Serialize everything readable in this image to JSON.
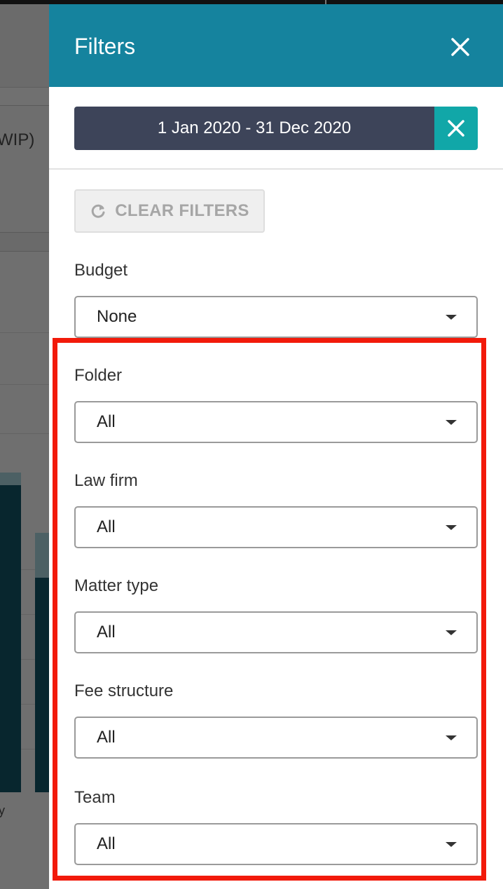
{
  "background": {
    "card_title_fragment": "WIP)",
    "axis_label_fragment": "y"
  },
  "panel": {
    "title": "Filters",
    "close_icon": "close-icon",
    "date_range": {
      "label": "1 Jan 2020 - 31 Dec 2020",
      "clear_icon": "close-icon"
    },
    "clear_filters": {
      "label": "CLEAR FILTERS",
      "icon": "refresh-icon"
    },
    "filters": [
      {
        "label": "Budget",
        "value": "None"
      },
      {
        "label": "Folder",
        "value": "All"
      },
      {
        "label": "Law firm",
        "value": "All"
      },
      {
        "label": "Matter type",
        "value": "All"
      },
      {
        "label": "Fee structure",
        "value": "All"
      },
      {
        "label": "Team",
        "value": "All"
      }
    ]
  },
  "colors": {
    "header": "#15839e",
    "date_label_bg": "#3d4459",
    "date_clear_bg": "#11a7a8",
    "highlight": "#f21a0a"
  }
}
